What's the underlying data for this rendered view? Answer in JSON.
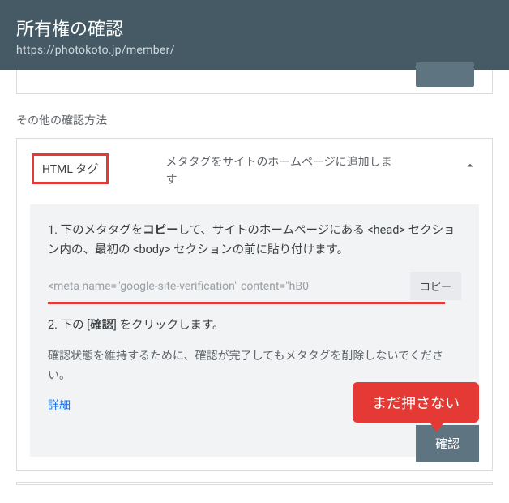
{
  "header": {
    "title": "所有権の確認",
    "url": "https://photokoto.jp/member/"
  },
  "section_label": "その他の確認方法",
  "method": {
    "name": "HTML タグ",
    "description": "メタタグをサイトのホームページに追加します"
  },
  "panel": {
    "step1_prefix": "1. 下のメタタグを",
    "step1_bold": "コピー",
    "step1_suffix": "して、サイトのホームページにある <head> セクション内の、最初の <body> セクションの前に貼り付けます。",
    "meta_code": "<meta name=\"google-site-verification\" content=\"hB0",
    "copy_label": "コピー",
    "step2_prefix": "2. 下の [",
    "step2_bold": "確認",
    "step2_suffix": "] をクリックします。",
    "hint": "確認状態を維持するために、確認が完了してもメタタグを削除しないでください。",
    "details_link": "詳細",
    "callout": "まだ押さない",
    "verify_label": "確認"
  }
}
